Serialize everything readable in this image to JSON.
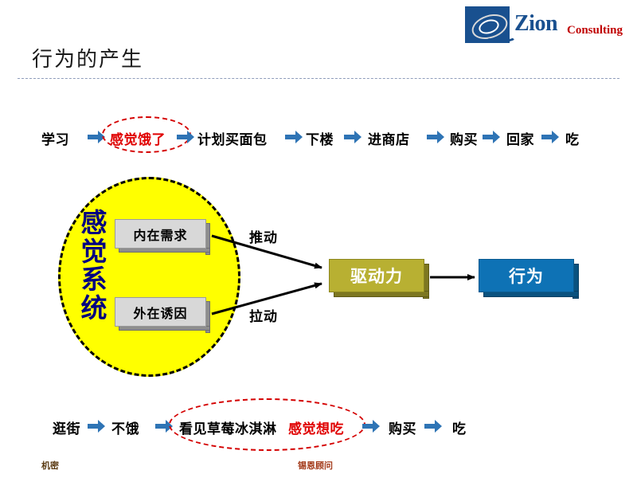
{
  "logo": {
    "name": "Zion",
    "subtitle": "Consulting"
  },
  "header": {
    "title": "行为的产生"
  },
  "top_flow": {
    "items": [
      "学习",
      "感觉饿了",
      "计划买面包",
      "下楼",
      "进商店",
      "购买",
      "回家",
      "吃"
    ],
    "highlighted_index": 1
  },
  "bottom_flow": {
    "items": [
      "逛街",
      "不饿",
      "看见草莓冰淇淋",
      "感觉想吃",
      "购买",
      "吃"
    ],
    "highlighted_index": 3
  },
  "diagram": {
    "system_label": "感觉系统",
    "inner_need": "内在需求",
    "outer_incentive": "外在诱因",
    "push_label": "推动",
    "pull_label": "拉动",
    "drive": "驱动力",
    "behavior": "行为"
  },
  "footer": {
    "left": "机密",
    "center": "锡恩顾问"
  },
  "colors": {
    "accent_red": "#e00000",
    "logo_blue": "#19508f",
    "ellipse_yellow": "#ffff00",
    "olive": "#b8b032",
    "blue": "#0e72b5",
    "navy_text": "#000080"
  }
}
